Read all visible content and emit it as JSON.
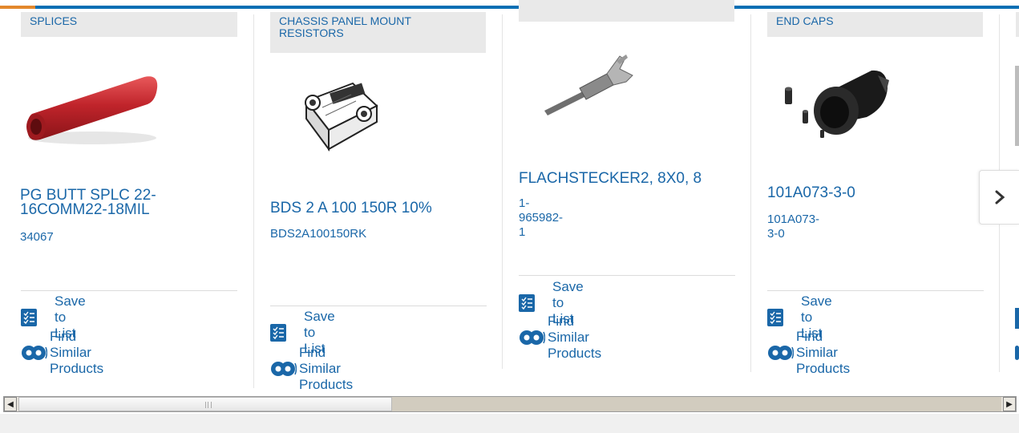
{
  "colors": {
    "brand": "#1a67a8",
    "accent_bar": "#0a6fb4",
    "accent_orange": "#e3882c",
    "category_bg": "#e9e9e9"
  },
  "cards": [
    {
      "category": "SPLICES",
      "title": "PG BUTT SPLC 22-16COMM22-18MIL",
      "part_number": "34067",
      "image": "red-butt-splice-image"
    },
    {
      "category": "CHASSIS PANEL MOUNT RESISTORS",
      "title": "BDS 2 A 100 150R 10%",
      "part_number": "BDS2A100150RK",
      "image": "panel-resistor-image"
    },
    {
      "category": "",
      "title": "FLACHSTECKER2, 8X0, 8",
      "part_number": "1-965982-1",
      "image": "flat-connector-terminal-image"
    },
    {
      "category": "END CAPS",
      "title": "101A073-3-0",
      "part_number": "101A073-3-0",
      "image": "end-caps-image"
    }
  ],
  "actions": {
    "save_label": "Save to List",
    "similar_label": "Find Similar Products"
  },
  "icons": {
    "save": "list-check-icon",
    "similar": "gears-icon",
    "next": "chevron-right-icon"
  },
  "scrollbar": {
    "left_arrow": "◀",
    "right_arrow": "▶",
    "grip": "III"
  }
}
